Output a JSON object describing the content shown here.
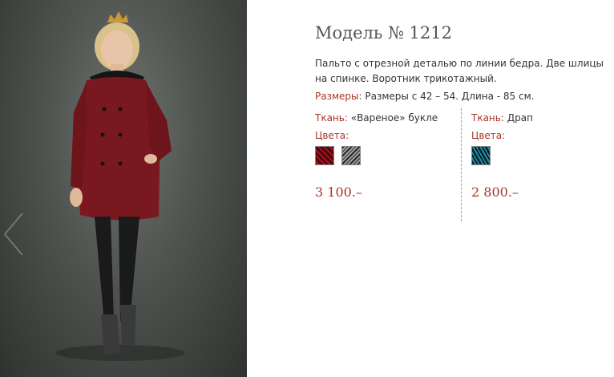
{
  "product": {
    "title": "Модель № 1212",
    "description": "Пальто с отрезной деталью по линии бедра. Две шлицы на спинке. Воротник трикотажный.",
    "sizes_label": "Размеры:",
    "sizes_value": "Размеры с 42 – 54. Длина - 85 см."
  },
  "variants": [
    {
      "fabric_label": "Ткань:",
      "fabric_value": "«Вареное» букле",
      "colors_label": "Цвета:",
      "swatches": [
        "red-boucle",
        "gray-boucle"
      ],
      "price": "3 100.–"
    },
    {
      "fabric_label": "Ткань:",
      "fabric_value": "Драп",
      "colors_label": "Цвета:",
      "swatches": [
        "teal-drape"
      ],
      "price": "2 800.–"
    }
  ],
  "colors": {
    "accent": "#a83427",
    "text": "#333333",
    "title": "#555555"
  }
}
